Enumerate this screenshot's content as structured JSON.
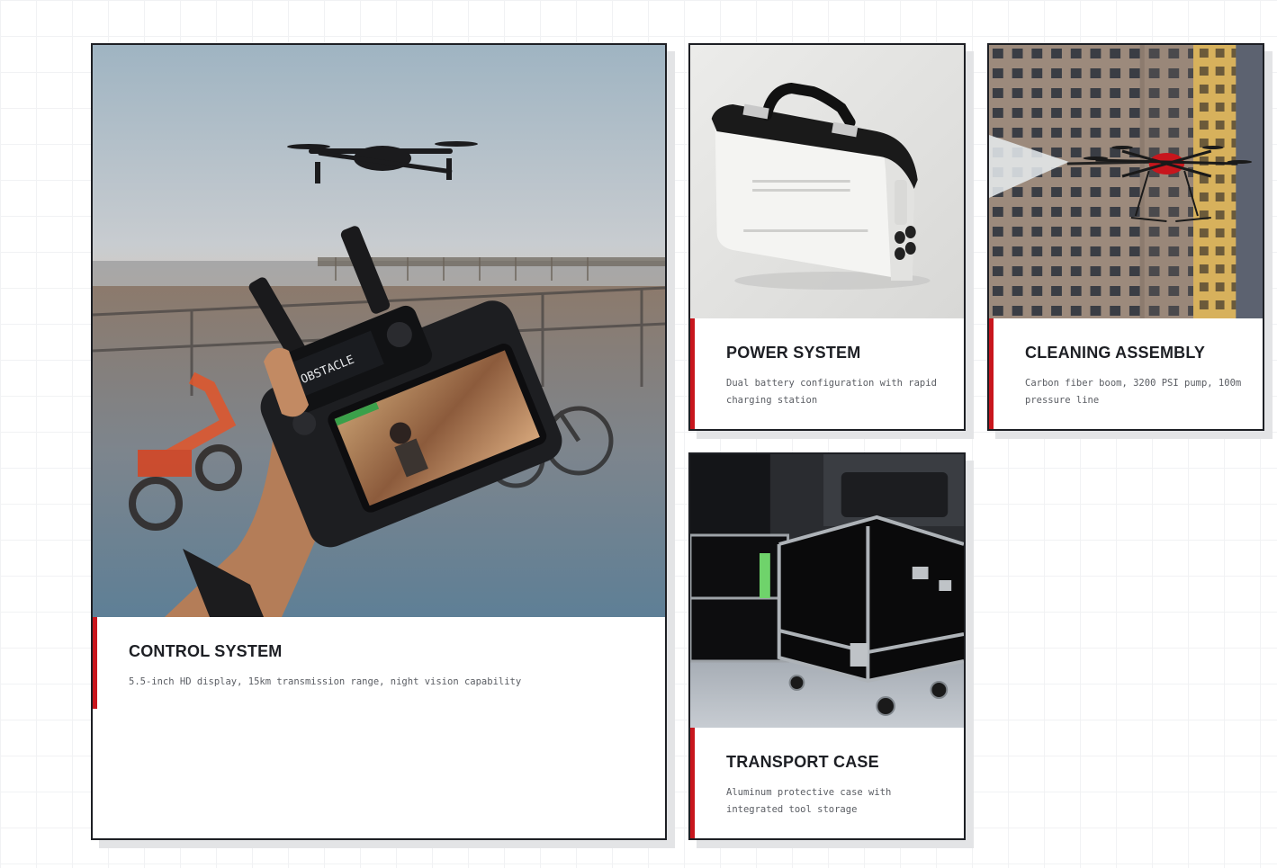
{
  "cards": [
    {
      "title": "CONTROL SYSTEM",
      "description": "5.5-inch HD display, 15km transmission range, night vision capability",
      "photo_screen_text": "OBSTACLE"
    },
    {
      "title": "POWER SYSTEM",
      "description": "Dual battery configuration with rapid charging station"
    },
    {
      "title": "CLEANING ASSEMBLY",
      "description": "Carbon fiber boom, 3200 PSI pump, 100m pressure line"
    },
    {
      "title": "TRANSPORT CASE",
      "description": "Aluminum protective case with integrated tool storage"
    }
  ],
  "colors": {
    "accent": "#c8161d",
    "border": "#1d1f24",
    "shadow": "#e3e4e6",
    "title": "#1d1f24",
    "text": "#5a5d63"
  }
}
